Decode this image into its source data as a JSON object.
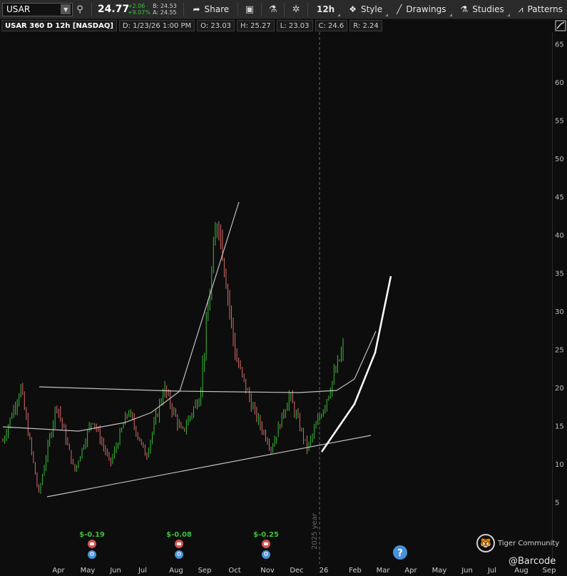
{
  "toolbar": {
    "symbol": "USAR",
    "last_price": "24.77",
    "change_abs": "+2.06",
    "change_pct": "+9.07%",
    "bid": "B: 24.53",
    "ask": "A: 24.55",
    "share_label": "Share",
    "aggregation": "12h",
    "style_label": "Style",
    "drawings_label": "Drawings",
    "studies_label": "Studies",
    "patterns_label": "Patterns"
  },
  "infobar": {
    "title": "USAR 360 D 12h [NASDAQ]",
    "date": "D: 1/23/26 1:00 PM",
    "open": "O: 23.03",
    "high": "H: 25.27",
    "low": "L: 23.03",
    "close": "C: 24.6",
    "range": "R: 2.24"
  },
  "colors": {
    "background": "#0d0d0d",
    "up_candle": "#3cb93c",
    "down_candle": "#d56a6a",
    "trendline": "#e0e0e0",
    "earnings_positive": "#3fbf3f",
    "earnings_icon": "#d9534f",
    "dividend_icon": "#4a90d9"
  },
  "chart_data": {
    "type": "candlestick",
    "ylim": [
      2,
      67
    ],
    "yticks": [
      5,
      10,
      15,
      20,
      25,
      30,
      35,
      40,
      45,
      50,
      55,
      60,
      65
    ],
    "xticks": [
      "Apr",
      "May",
      "Jun",
      "Jul",
      "Aug",
      "Sep",
      "Oct",
      "Nov",
      "Dec",
      "26",
      "Feb",
      "Mar",
      "Apr",
      "May",
      "Jun",
      "Jul",
      "Aug",
      "Sep"
    ],
    "year_marker": "2025 year",
    "price_path": [
      {
        "month": "Mar",
        "price": 13
      },
      {
        "month": "Mar",
        "price": 20
      },
      {
        "month": "Apr",
        "price": 6
      },
      {
        "month": "Apr",
        "price": 18
      },
      {
        "month": "May",
        "price": 9
      },
      {
        "month": "Jun",
        "price": 16
      },
      {
        "month": "Jul",
        "price": 10
      },
      {
        "month": "Jul",
        "price": 17
      },
      {
        "month": "Aug",
        "price": 11
      },
      {
        "month": "Aug",
        "price": 20
      },
      {
        "month": "Sep",
        "price": 14
      },
      {
        "month": "Sep",
        "price": 19
      },
      {
        "month": "Oct",
        "price": 43
      },
      {
        "month": "Oct",
        "price": 24
      },
      {
        "month": "Nov",
        "price": 17
      },
      {
        "month": "Nov",
        "price": 12
      },
      {
        "month": "Dec",
        "price": 19
      },
      {
        "month": "Dec",
        "price": 12
      },
      {
        "month": "Jan",
        "price": 18
      },
      {
        "month": "Jan",
        "price": 25
      }
    ],
    "earnings": [
      {
        "month": "May",
        "value": "$-0.19"
      },
      {
        "month": "Aug",
        "value": "$-0.08"
      },
      {
        "month": "Nov",
        "value": "$-0.25"
      }
    ]
  },
  "watermark": {
    "brand": "Tiger Community",
    "handle": "@Barcode",
    "logo": "tiger-logo"
  }
}
